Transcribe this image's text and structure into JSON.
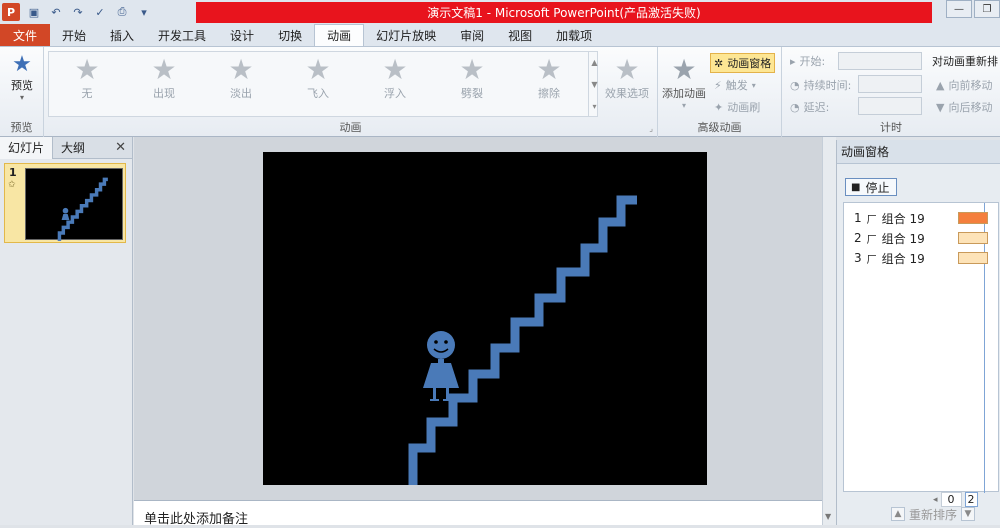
{
  "window": {
    "title": "演示文稿1 - Microsoft PowerPoint(产品激活失败)",
    "title_bar_color": "#e8141d"
  },
  "menu_tabs": [
    {
      "label": "文件",
      "state": "file"
    },
    {
      "label": "开始"
    },
    {
      "label": "插入"
    },
    {
      "label": "开发工具"
    },
    {
      "label": "设计"
    },
    {
      "label": "切换"
    },
    {
      "label": "动画",
      "state": "active"
    },
    {
      "label": "幻灯片放映"
    },
    {
      "label": "审阅"
    },
    {
      "label": "视图"
    },
    {
      "label": "加载项"
    }
  ],
  "ribbon": {
    "preview_group": {
      "button_label": "预览",
      "group_label": "预览"
    },
    "animation_group": {
      "group_label": "动画",
      "items": [
        "无",
        "出现",
        "淡出",
        "飞入",
        "浮入",
        "劈裂",
        "擦除"
      ],
      "effect_options_label": "效果选项"
    },
    "advanced_group": {
      "group_label": "高级动画",
      "add_animation_label": "添加动画",
      "animation_pane_label": "动画窗格",
      "trigger_label": "触发",
      "painter_label": "动画刷"
    },
    "timing_group": {
      "group_label": "计时",
      "start_label": "开始:",
      "duration_label": "持续时间:",
      "delay_label": "延迟:",
      "reorder_title": "对动画重新排",
      "move_earlier": "向前移动",
      "move_later": "向后移动"
    }
  },
  "left_panel": {
    "tabs": [
      "幻灯片",
      "大纲"
    ],
    "slide_number": "1"
  },
  "notes_placeholder": "单击此处添加备注",
  "animation_pane": {
    "title": "动画窗格",
    "stop_label": "停止",
    "items": [
      {
        "index": "1",
        "name": "组合 19",
        "bar_color": "#f47f3d"
      },
      {
        "index": "2",
        "name": "组合 19",
        "bar_color": "#fde3b8"
      },
      {
        "index": "3",
        "name": "组合 19",
        "bar_color": "#fde3b8"
      }
    ],
    "timeline_start": "0",
    "timeline_next": "2",
    "reorder_label": "重新排序"
  },
  "colors": {
    "figure_blue": "#4a7ab8",
    "file_tab": "#d24726"
  }
}
